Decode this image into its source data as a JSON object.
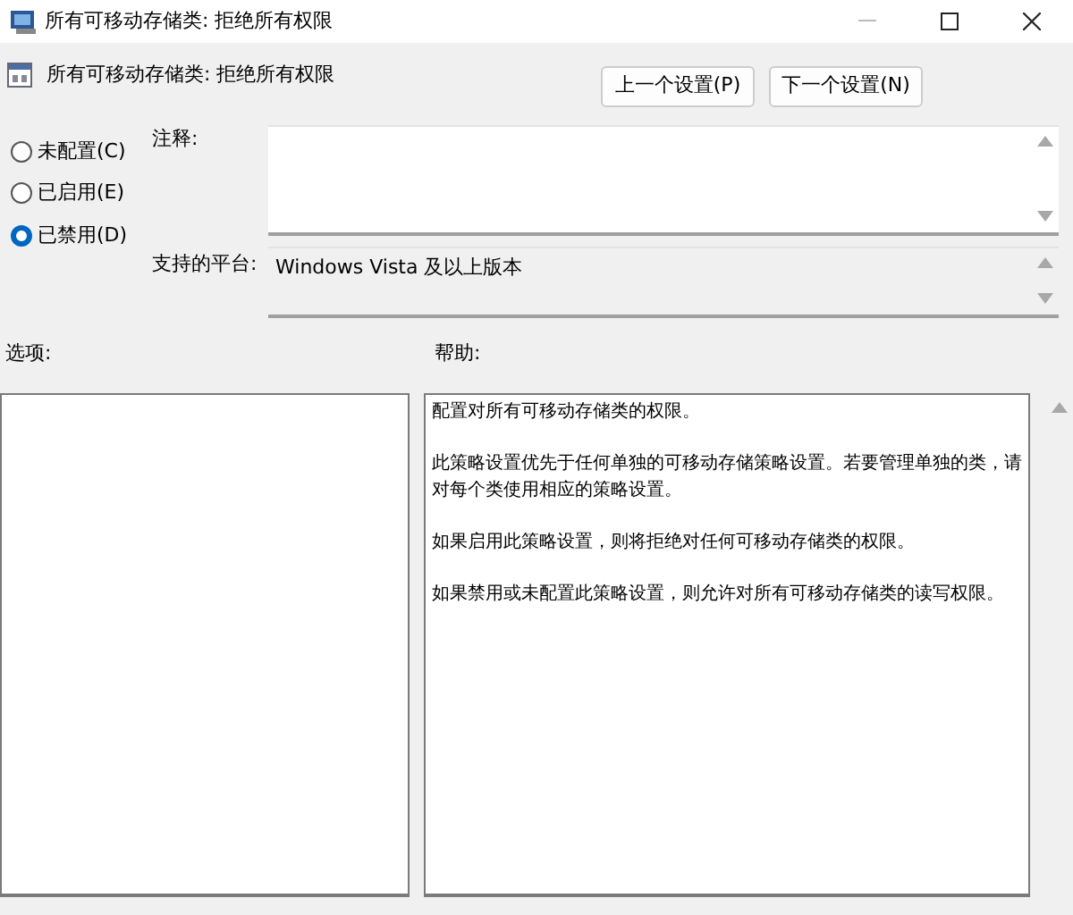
{
  "window": {
    "title": "所有可移动存储类: 拒绝所有权限"
  },
  "header": {
    "title": "所有可移动存储类: 拒绝所有权限"
  },
  "nav_buttons": [
    "上一个设置(P)",
    "下一个设置(N)"
  ],
  "options": [
    {
      "label": "未配置(C)",
      "selected": false
    },
    {
      "label": "已启用(E)",
      "selected": false
    },
    {
      "label": "已禁用(D)",
      "selected": true
    }
  ],
  "comment": {
    "label": "注释:"
  },
  "platform": {
    "label": "支持的平台:",
    "value": "Windows Vista 及以上版本"
  },
  "options_label": "选项:",
  "help_label": "帮助:",
  "help_paragraphs": [
    "配置对所有可移动存储类的权限。",
    "此策略设置优先于任何单独的可移动存储策略设置。若要管理单独的类，请对每个类使用相应的策略设置。",
    "如果启用此策略设置，则将拒绝对任何可移动存储类的权限。",
    "如果禁用或未配置此策略设置，则允许对所有可移动存储类的读写权限。"
  ]
}
